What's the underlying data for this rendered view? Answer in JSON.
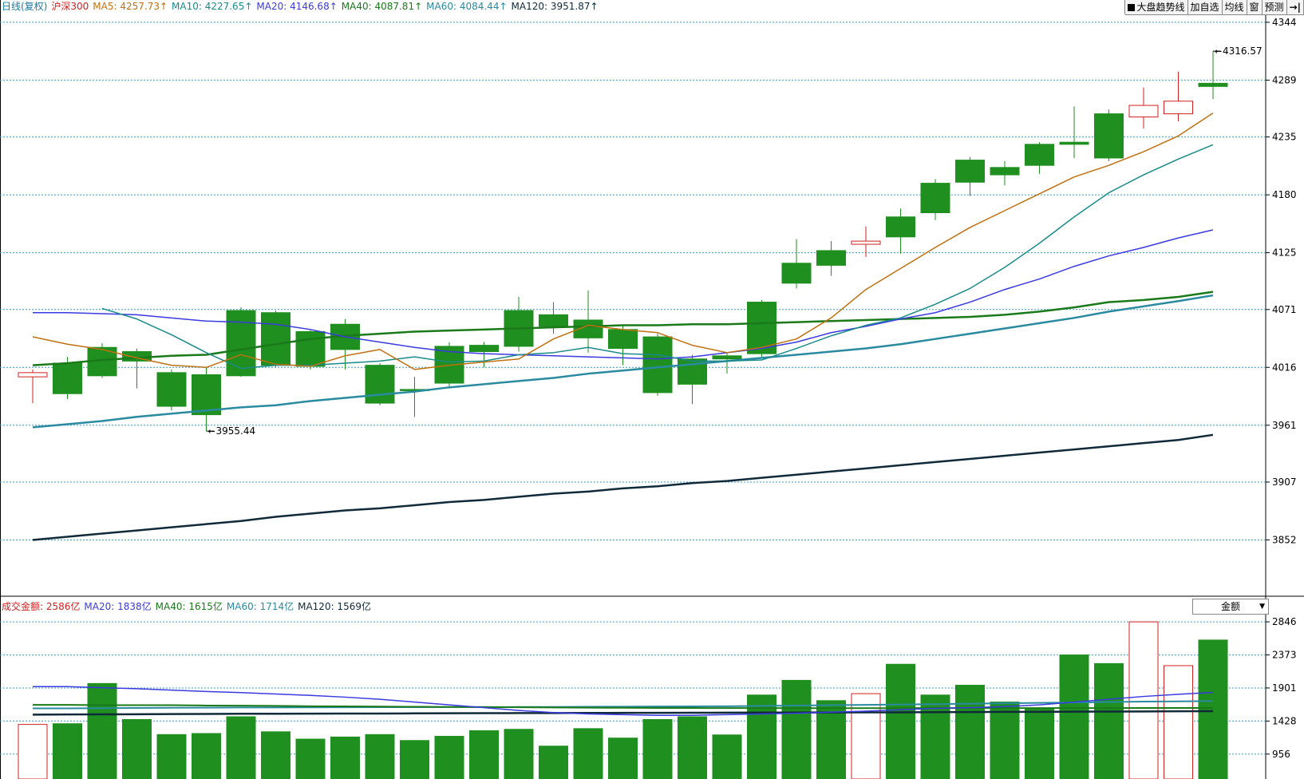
{
  "price_legend": {
    "period": "日线(复权)",
    "symbol": "沪深300",
    "items": [
      {
        "label": "MA5: 4257.73↑",
        "color": "#c07010"
      },
      {
        "label": "MA10: 4227.65↑",
        "color": "#1a8a8a"
      },
      {
        "label": "MA20: 4146.68↑",
        "color": "#3a3ae0"
      },
      {
        "label": "MA40: 4087.81↑",
        "color": "#1a7a1a"
      },
      {
        "label": "MA60: 4084.44↑",
        "color": "#2a8aa0"
      },
      {
        "label": "MA120: 3951.87↑",
        "color": "#102a3a"
      }
    ]
  },
  "volume_legend": {
    "title": "成交金额: 2586亿",
    "items": [
      {
        "label": "MA20: 1838亿",
        "color": "#3a3ae0"
      },
      {
        "label": "MA40: 1615亿",
        "color": "#1a7a1a"
      },
      {
        "label": "MA60: 1714亿",
        "color": "#2a8aa0"
      },
      {
        "label": "MA120: 1569亿",
        "color": "#102a3a"
      }
    ]
  },
  "toolbar": {
    "trend_label": "大盘趋势线",
    "add_watch_label": "加自选",
    "avg_line_label": "均线",
    "window_label": "窗",
    "forecast_label": "预测",
    "exit_label": "→|"
  },
  "volume_selector": {
    "value": "金额"
  },
  "price_axis": {
    "ticks": [
      "4344",
      "4289",
      "4235",
      "4180",
      "4125",
      "4071",
      "4016",
      "3961",
      "3907",
      "3852"
    ],
    "min": 3800,
    "max": 4350
  },
  "volume_axis": {
    "ticks": [
      "2846",
      "2373",
      "1901",
      "1428",
      "956"
    ],
    "min": 600,
    "max": 2950
  },
  "annotations": {
    "high_label": "4316.57",
    "low_label": "3955.44"
  },
  "colors": {
    "up": "#d42020",
    "down": "#1f8f1f",
    "grid": "#3aa0c0",
    "axis": "#000000"
  },
  "chart_data": {
    "type": "candlestick",
    "ohlc": [
      [
        4007,
        4014,
        3982,
        4011
      ],
      [
        4020,
        4026,
        3986,
        3991
      ],
      [
        4035,
        4039,
        4006,
        4008
      ],
      [
        4031,
        4034,
        3996,
        4022
      ],
      [
        4011,
        4014,
        3975,
        3979
      ],
      [
        4009,
        4016,
        3955.44,
        3971
      ],
      [
        4070,
        4073,
        4007,
        4008
      ],
      [
        4068,
        4070,
        4016,
        4018
      ],
      [
        4050,
        4052,
        4014,
        4017
      ],
      [
        4057,
        4062,
        4014,
        4033
      ],
      [
        4018,
        4020,
        3980,
        3982
      ],
      [
        3995,
        4007,
        3969,
        3994
      ],
      [
        4036,
        4040,
        3996,
        4001
      ],
      [
        4037,
        4040,
        4016,
        4031
      ],
      [
        4070,
        4083,
        4031,
        4036
      ],
      [
        4066,
        4078,
        4048,
        4055
      ],
      [
        4061,
        4089,
        4030,
        4044
      ],
      [
        4052,
        4056,
        4018,
        4034
      ],
      [
        4045,
        4048,
        3989,
        3992
      ],
      [
        4024,
        4028,
        3981,
        4000
      ],
      [
        4027,
        4030,
        4010,
        4024
      ],
      [
        4078,
        4080,
        4026,
        4029
      ],
      [
        4115,
        4138,
        4091,
        4096
      ],
      [
        4127,
        4136,
        4103,
        4113
      ],
      [
        4133,
        4150,
        4121,
        4136
      ],
      [
        4159,
        4167,
        4124,
        4140
      ],
      [
        4191,
        4195,
        4156,
        4163
      ],
      [
        4213,
        4216,
        4179,
        4192
      ],
      [
        4206,
        4212,
        4189,
        4199
      ],
      [
        4228,
        4230,
        4200,
        4208
      ],
      [
        4230,
        4264,
        4215,
        4228
      ],
      [
        4257,
        4261,
        4212,
        4215
      ],
      [
        4254,
        4282,
        4243,
        4265
      ],
      [
        4257,
        4297,
        4250,
        4269
      ],
      [
        4286,
        4316.57,
        4271,
        4283
      ]
    ],
    "ma5": [
      4045,
      4038,
      4033,
      4025,
      4018,
      4016,
      4028,
      4019,
      4017,
      4027,
      4033,
      4014,
      4018,
      4021,
      4024,
      4043,
      4056,
      4052,
      4049,
      4037,
      4030,
      4035,
      4043,
      4063,
      4090,
      4110,
      4130,
      4149,
      4165,
      4181,
      4197,
      4208,
      4221,
      4236,
      4257.73
    ],
    "ma10": [
      4072,
      4062,
      4047,
      4030,
      4015,
      4018,
      4018,
      4020,
      4022,
      4026,
      4021,
      4022,
      4028,
      4030,
      4035,
      4029,
      4028,
      4022,
      4022,
      4023,
      4034,
      4046,
      4056,
      4063,
      4076,
      4091,
      4111,
      4134,
      4159,
      4182,
      4199,
      4214,
      4227.65
    ],
    "ma20": [
      4068,
      4068,
      4067,
      4066,
      4063,
      4060,
      4059,
      4057,
      4052,
      4045,
      4040,
      4035,
      4031,
      4029,
      4028,
      4027,
      4026,
      4025,
      4024,
      4026,
      4030,
      4034,
      4040,
      4049,
      4055,
      4062,
      4068,
      4078,
      4090,
      4100,
      4112,
      4122,
      4130,
      4139,
      4146.68
    ],
    "ma40": [
      4018,
      4020,
      4023,
      4025,
      4027,
      4028,
      4033,
      4038,
      4043,
      4046,
      4048,
      4050,
      4051,
      4052,
      4053,
      4054,
      4055,
      4056,
      4056,
      4057,
      4057,
      4058,
      4059,
      4060,
      4061,
      4062,
      4063,
      4064,
      4066,
      4069,
      4073,
      4078,
      4080,
      4083,
      4087.81
    ],
    "ma60": [
      3959,
      3962,
      3965,
      3969,
      3972,
      3975,
      3978,
      3980,
      3984,
      3987,
      3990,
      3993,
      3997,
      4000,
      4003,
      4006,
      4010,
      4013,
      4016,
      4019,
      4022,
      4025,
      4028,
      4031,
      4034,
      4038,
      4043,
      4048,
      4053,
      4058,
      4063,
      4069,
      4074,
      4079,
      4084.44
    ],
    "ma120": [
      3852,
      3855,
      3858,
      3861,
      3864,
      3867,
      3870,
      3874,
      3877,
      3880,
      3882,
      3885,
      3888,
      3890,
      3893,
      3896,
      3898,
      3901,
      3903,
      3906,
      3908,
      3911,
      3914,
      3917,
      3920,
      3923,
      3926,
      3929,
      3932,
      3935,
      3938,
      3941,
      3944,
      3947,
      3951.87
    ],
    "amount": [
      1380,
      1390,
      1965,
      1450,
      1235,
      1250,
      1490,
      1275,
      1170,
      1200,
      1235,
      1150,
      1210,
      1290,
      1310,
      1070,
      1320,
      1185,
      1450,
      1490,
      1230,
      1800,
      2010,
      1720,
      1820,
      2240,
      1800,
      1940,
      1700,
      1600,
      2373,
      2250,
      2846,
      2220,
      2586
    ],
    "amount_ma20": [
      1920,
      1920,
      1905,
      1890,
      1870,
      1850,
      1835,
      1815,
      1795,
      1770,
      1740,
      1700,
      1660,
      1620,
      1580,
      1550,
      1530,
      1520,
      1510,
      1510,
      1520,
      1530,
      1540,
      1555,
      1570,
      1590,
      1610,
      1620,
      1635,
      1660,
      1700,
      1740,
      1780,
      1810,
      1838
    ],
    "amount_ma40": [
      1660,
      1660,
      1655,
      1655,
      1655,
      1650,
      1648,
      1645,
      1640,
      1638,
      1635,
      1632,
      1630,
      1628,
      1625,
      1622,
      1620,
      1618,
      1616,
      1615,
      1614,
      1614,
      1613,
      1613,
      1613,
      1613,
      1614,
      1614,
      1614,
      1614,
      1614,
      1614,
      1615,
      1615,
      1615
    ],
    "amount_ma60": [
      1610,
      1610,
      1612,
      1615,
      1618,
      1620,
      1622,
      1623,
      1624,
      1625,
      1626,
      1627,
      1628,
      1628,
      1629,
      1630,
      1632,
      1634,
      1636,
      1638,
      1640,
      1645,
      1650,
      1655,
      1660,
      1665,
      1670,
      1676,
      1682,
      1688,
      1694,
      1700,
      1706,
      1710,
      1714
    ],
    "amount_ma120": [
      1520,
      1522,
      1524,
      1526,
      1528,
      1530,
      1532,
      1533,
      1534,
      1535,
      1536,
      1538,
      1540,
      1541,
      1542,
      1543,
      1544,
      1545,
      1546,
      1547,
      1548,
      1549,
      1550,
      1551,
      1552,
      1553,
      1555,
      1557,
      1559,
      1560,
      1562,
      1564,
      1566,
      1568,
      1569
    ]
  }
}
